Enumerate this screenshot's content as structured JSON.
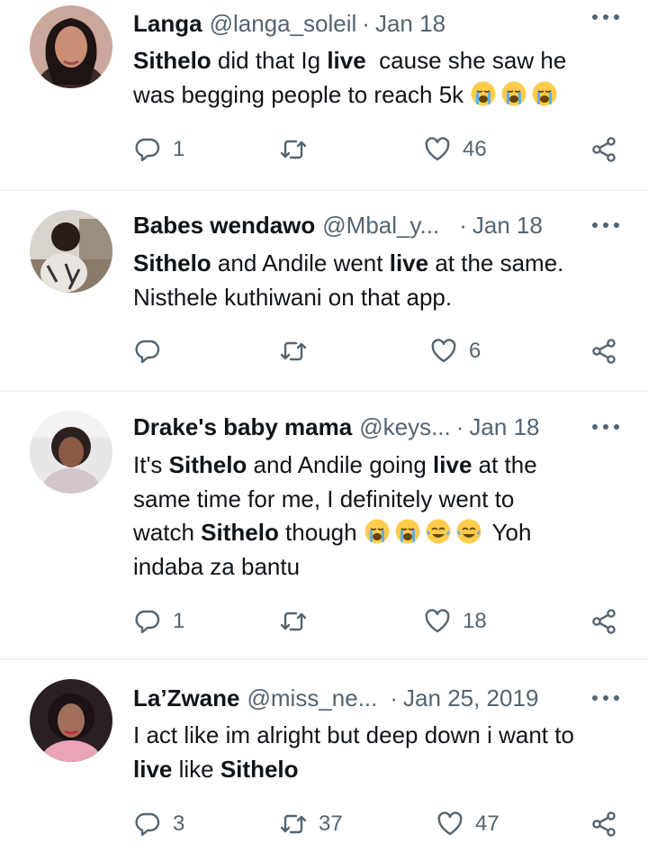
{
  "tweets": [
    {
      "name": "Langa",
      "handle": "@langa_soleil",
      "date": "Jan 18",
      "text_lines": [
        [
          {
            "t": "Sithelo",
            "b": true
          },
          {
            "t": " did that Ig ",
            "b": false
          },
          {
            "t": "live",
            "b": true
          },
          {
            "t": "  cause she saw he",
            "b": false
          }
        ],
        [
          {
            "t": "was begging people to reach 5k ",
            "b": false
          },
          {
            "emoji": "loudly-crying-face"
          },
          {
            "emoji": "loudly-crying-face"
          },
          {
            "emoji": "loudly-crying-face"
          }
        ]
      ],
      "replies": "1",
      "retweets": "",
      "likes": "46"
    },
    {
      "name": "Babes wendawo",
      "handle": "@Mbal_y...",
      "date": "Jan 18",
      "text_lines": [
        [
          {
            "t": "Sithelo",
            "b": true
          },
          {
            "t": " and Andile went ",
            "b": false
          },
          {
            "t": "live",
            "b": true
          },
          {
            "t": " at the same.",
            "b": false
          }
        ],
        [
          {
            "t": "Nisthele kuthiwani on that app.",
            "b": false
          }
        ]
      ],
      "replies": "",
      "retweets": "",
      "likes": "6"
    },
    {
      "name": "Drake's baby mama",
      "handle": "@keys...",
      "date": "Jan 18",
      "text_lines": [
        [
          {
            "t": "It's ",
            "b": false
          },
          {
            "t": "Sithelo",
            "b": true
          },
          {
            "t": " and Andile going ",
            "b": false
          },
          {
            "t": "live",
            "b": true
          },
          {
            "t": " at the",
            "b": false
          }
        ],
        [
          {
            "t": "same time for me, I definitely went to",
            "b": false
          }
        ],
        [
          {
            "t": "watch ",
            "b": false
          },
          {
            "t": "Sithelo",
            "b": true
          },
          {
            "t": " though ",
            "b": false
          },
          {
            "emoji": "loudly-crying-face"
          },
          {
            "emoji": "loudly-crying-face"
          },
          {
            "emoji": "face-with-tears-of-joy"
          },
          {
            "emoji": "face-with-tears-of-joy"
          },
          {
            "t": " Yoh",
            "b": false
          }
        ],
        [
          {
            "t": "indaba za bantu",
            "b": false
          }
        ]
      ],
      "replies": "1",
      "retweets": "",
      "likes": "18"
    },
    {
      "name": "La’Zwane",
      "handle": "@miss_ne...",
      "date": "Jan 25, 2019",
      "text_lines": [
        [
          {
            "t": "I act like im alright but deep down i want to",
            "b": false
          }
        ],
        [
          {
            "t": "live",
            "b": true
          },
          {
            "t": " like ",
            "b": false
          },
          {
            "t": "Sithelo",
            "b": true
          }
        ]
      ],
      "replies": "3",
      "retweets": "37",
      "likes": "47"
    }
  ],
  "icons": {
    "reply": "reply-icon",
    "retweet": "retweet-icon",
    "like": "like-icon",
    "share": "share-icon",
    "more": "more-icon"
  },
  "colors": {
    "text": "#0f1419",
    "secondary": "#536471",
    "divider": "#eff3f4"
  }
}
